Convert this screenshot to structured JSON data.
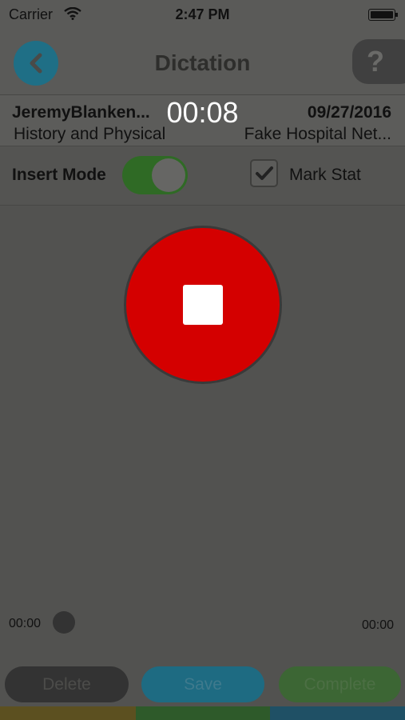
{
  "status_bar": {
    "carrier": "Carrier",
    "time": "2:47 PM"
  },
  "nav": {
    "title": "Dictation",
    "help_label": "?"
  },
  "info": {
    "patient": "JeremyBlanken...",
    "timer": "00:08",
    "date": "09/27/2016",
    "note_type": "History and Physical",
    "facility": "Fake Hospital Net..."
  },
  "mode": {
    "insert_label": "Insert Mode",
    "insert_on": true,
    "stat_label": "Mark Stat",
    "stat_checked": true
  },
  "playback": {
    "position": "00:00",
    "duration": "00:00"
  },
  "actions": {
    "delete": "Delete",
    "save": "Save",
    "complete": "Complete"
  },
  "colors": {
    "record": "#d40000",
    "accent": "#1e6b82",
    "toggle_on": "#2f6a25"
  }
}
